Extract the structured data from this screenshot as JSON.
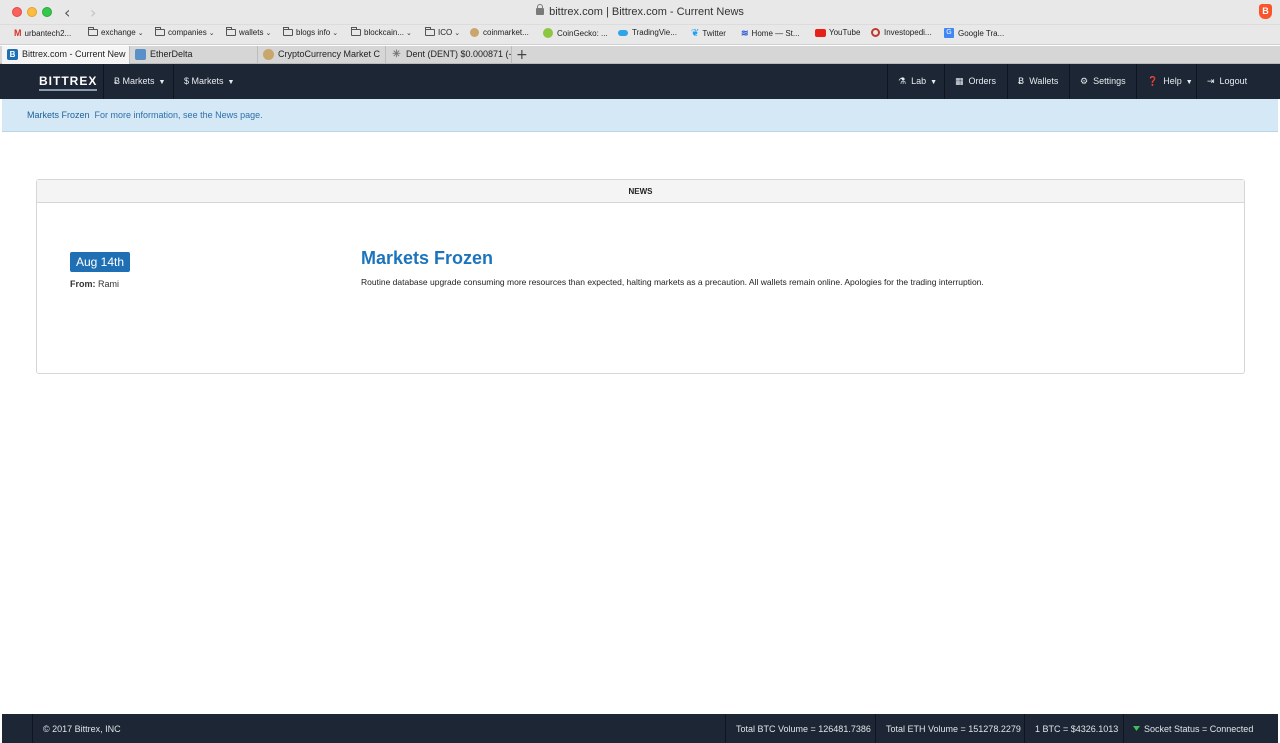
{
  "browser": {
    "address": "bittrex.com | Bittrex.com - Current News",
    "bookmarks": [
      {
        "label": "urbantech2...",
        "icon": "gmail-icon",
        "folder": false,
        "caret": false
      },
      {
        "label": "exchange",
        "icon": "folder-icon",
        "folder": true,
        "caret": true
      },
      {
        "label": "companies",
        "icon": "folder-icon",
        "folder": true,
        "caret": true
      },
      {
        "label": "wallets",
        "icon": "folder-icon",
        "folder": true,
        "caret": true
      },
      {
        "label": "blogs info",
        "icon": "folder-icon",
        "folder": true,
        "caret": true
      },
      {
        "label": "blockcain...",
        "icon": "folder-icon",
        "folder": true,
        "caret": true
      },
      {
        "label": "ICO",
        "icon": "folder-icon",
        "folder": true,
        "caret": true
      },
      {
        "label": "coinmarket...",
        "icon": "coinmarketcap-icon",
        "folder": false,
        "caret": false
      },
      {
        "label": "CoinGecko: ...",
        "icon": "coingecko-icon",
        "folder": false,
        "caret": false
      },
      {
        "label": "TradingVie...",
        "icon": "tradingview-icon",
        "folder": false,
        "caret": false
      },
      {
        "label": "Twitter",
        "icon": "twitter-icon",
        "folder": false,
        "caret": false
      },
      {
        "label": "Home — St...",
        "icon": "steemit-icon",
        "folder": false,
        "caret": false
      },
      {
        "label": "YouTube",
        "icon": "youtube-icon",
        "folder": false,
        "caret": false
      },
      {
        "label": "Investopedi...",
        "icon": "investopedia-icon",
        "folder": false,
        "caret": false
      },
      {
        "label": "Google Tra...",
        "icon": "google-translate-icon",
        "folder": false,
        "caret": false
      }
    ],
    "tabs": [
      {
        "label": "Bittrex.com - Current New",
        "icon": "bittrex-favicon",
        "active": true
      },
      {
        "label": "EtherDelta",
        "icon": "etherdelta-favicon",
        "active": false
      },
      {
        "label": "CryptoCurrency Market C",
        "icon": "coinmarketcap-favicon",
        "active": false
      },
      {
        "label": "Dent (DENT) $0.000871 (-",
        "icon": "dent-favicon",
        "active": false
      }
    ]
  },
  "site_nav": {
    "logo": "BITTREX",
    "left": [
      {
        "label": "Ƀ Markets"
      },
      {
        "label": "$ Markets"
      }
    ],
    "right": [
      {
        "label": "Lab",
        "icon": "flask-icon",
        "caret": true
      },
      {
        "label": "Orders",
        "icon": "calendar-icon",
        "caret": false
      },
      {
        "label": "Wallets",
        "icon": "bitcoin-icon",
        "caret": false
      },
      {
        "label": "Settings",
        "icon": "gear-icon",
        "caret": false
      },
      {
        "label": "Help",
        "icon": "question-icon",
        "caret": true
      },
      {
        "label": "Logout",
        "icon": "logout-icon",
        "caret": false
      }
    ]
  },
  "alert": {
    "title": "Markets Frozen",
    "message": "For more information, see the News page."
  },
  "news": {
    "heading": "NEWS",
    "date": "Aug 14th",
    "from_label": "From:",
    "from": "Rami",
    "title": "Markets Frozen",
    "body": "Routine database upgrade consuming more resources than expected, halting markets as a precaution. All wallets remain online. Apologies for the trading interruption."
  },
  "footer": {
    "copyright": "© 2017 Bittrex, INC",
    "btc_volume": "Total BTC Volume = 126481.7386",
    "eth_volume": "Total ETH Volume = 151278.2279",
    "btc_price": "1 BTC = $4326.1013",
    "socket_status": "Socket Status = Connected"
  },
  "colors": {
    "nav_bg": "#1d2634",
    "accent": "#1c75bc",
    "alert_bg": "#d4e8f6",
    "status_connected": "#3cbf5a"
  }
}
